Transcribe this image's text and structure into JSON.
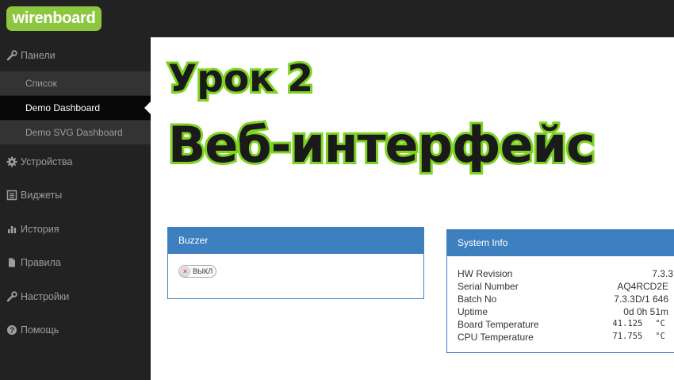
{
  "app": {
    "logo_text": "wirenboard",
    "brand_color": "#8dc63f"
  },
  "sidebar": {
    "items": [
      {
        "label": "Панели",
        "icon": "wrench-icon"
      },
      {
        "label": "Устройства",
        "icon": "gear-icon"
      },
      {
        "label": "Виджеты",
        "icon": "list-icon"
      },
      {
        "label": "История",
        "icon": "bar-chart-icon"
      },
      {
        "label": "Правила",
        "icon": "document-icon"
      },
      {
        "label": "Настройки",
        "icon": "wrench-icon"
      },
      {
        "label": "Помощь",
        "icon": "question-icon"
      }
    ],
    "subitems": [
      {
        "label": "Список"
      },
      {
        "label": "Demo Dashboard",
        "active": true
      },
      {
        "label": "Demo SVG Dashboard"
      }
    ]
  },
  "overlay": {
    "line1": "Урок 2",
    "line2": "Веб-интерфейс",
    "outline_color": "#7ed321"
  },
  "buzzer": {
    "title": "Buzzer",
    "toggle_label": "ВЫКЛ",
    "toggle_state": "off"
  },
  "system_info": {
    "title": "System Info",
    "rows": [
      {
        "label": "HW Revision",
        "value": "7.3.3"
      },
      {
        "label": "Serial Number",
        "value": "AQ4RCD2E"
      },
      {
        "label": "Batch No",
        "value": "7.3.3D/1 646"
      },
      {
        "label": "Uptime",
        "value": "0d 0h 51m"
      },
      {
        "label": "Board Temperature",
        "value": "41.125",
        "unit": "°C"
      },
      {
        "label": "CPU Temperature",
        "value": "71.755",
        "unit": "°C"
      }
    ]
  },
  "panel_color": "#3e7fbf"
}
